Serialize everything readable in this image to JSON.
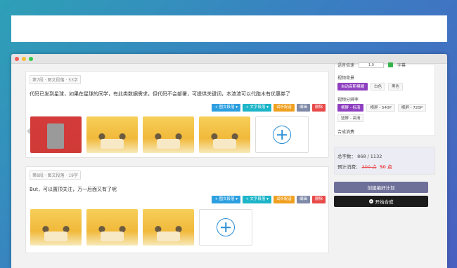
{
  "cards": [
    {
      "tag": "第7段 · 图文段落 · 53字",
      "text": "代码已发到星球，如果在星球的同学，有此类数据需求，但代码不会部署，可提供关键词，本渣渣可以代跑木有优惠券了"
    },
    {
      "tag": "第8段 · 图文段落 · 19字",
      "text": "But，可以置顶关注，万一后面又有了呢"
    }
  ],
  "buttons": {
    "image_para": "+ 图文段落 ▾",
    "text_para": "+ 文字段落 ▾",
    "voice": "试听配音",
    "edit": "编辑",
    "delete": "删除"
  },
  "side": {
    "top_cut_label": "语音倍速",
    "top_cut_value": "1.0",
    "top_cut_check": "字幕",
    "bg_label": "视频背景",
    "bg_options": [
      "自动高斯模糊",
      "白色",
      "黑色"
    ],
    "res_label": "视频分辨率",
    "res_options": [
      "横屏 - 标清",
      "横屏 - 540P",
      "横屏 - 720P",
      "竖屏 - 高清"
    ],
    "cost_label": "合成消费",
    "total_words": "总字数：  868 / 1132",
    "est_prefix": "预计消费：",
    "est_old": "300 点",
    "est_new": "50 点",
    "plan_btn": "创建编好计划",
    "start_btn": "开始合成"
  }
}
